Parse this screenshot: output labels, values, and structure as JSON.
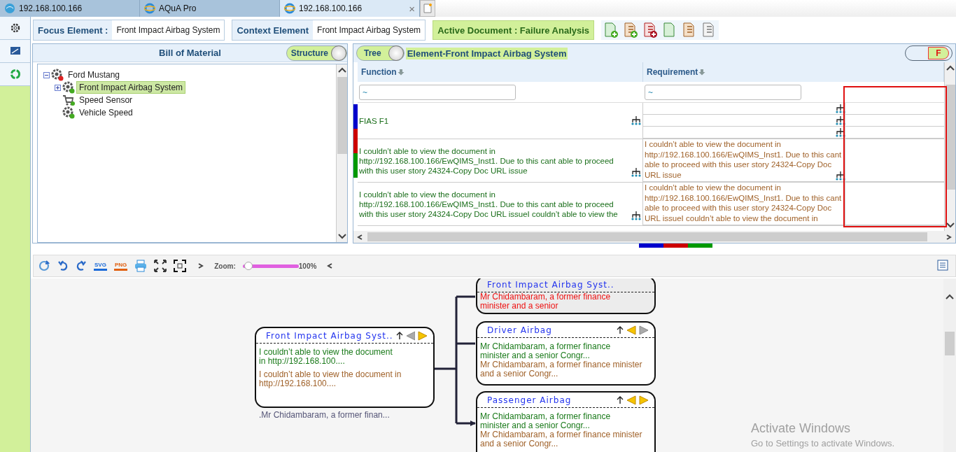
{
  "browser_tabs": [
    {
      "title": "192.168.100.166",
      "kind": "globe",
      "selected": false
    },
    {
      "title": "AQuA Pro",
      "kind": "ie",
      "selected": false
    },
    {
      "title": "192.168.100.166",
      "kind": "ie",
      "selected": true,
      "close": "×"
    }
  ],
  "sidebar": {
    "items": [
      {
        "kind": "settings"
      },
      {
        "kind": "screen"
      },
      {
        "kind": "cycle"
      }
    ]
  },
  "focus_element": {
    "label": "Focus Element :",
    "value": "Front Impact Airbag System"
  },
  "context_element": {
    "label": "Context Element",
    "value": "Front Impact Airbag System"
  },
  "active_document": {
    "label": "Active Document : Failure Analysis"
  },
  "doc_tools": [
    {
      "kind": "new-doc"
    },
    {
      "kind": "add-checklist"
    },
    {
      "kind": "remove-list"
    },
    {
      "kind": "doc"
    },
    {
      "kind": "checklist"
    },
    {
      "kind": "list"
    }
  ],
  "bom": {
    "title": "Bill of Material",
    "toggle": {
      "label": "Structure",
      "on": true
    },
    "tree": [
      {
        "label": "Ford Mustang",
        "kind": "assembly",
        "expanded": true,
        "selected": false,
        "children": [
          {
            "label": "Front Impact Airbag System",
            "kind": "system",
            "expanded": false,
            "selected": true
          },
          {
            "label": "Speed Sensor",
            "kind": "sensor",
            "selected": false
          },
          {
            "label": "Vehicle Speed",
            "kind": "function",
            "selected": false
          }
        ]
      }
    ]
  },
  "grid": {
    "toggle": {
      "label": "Tree",
      "on": true
    },
    "title": "Element-Front Impact Airbag System",
    "mode_toggle": {
      "label": "F",
      "on": true
    },
    "columns": [
      {
        "label": "Function"
      },
      {
        "label": "Requirement"
      }
    ],
    "filters": [
      "~",
      "~"
    ],
    "side_markers": [
      {
        "color": "#0000cc"
      },
      {
        "color": "#cc0000"
      },
      {
        "color": "#009900"
      }
    ],
    "rows": [
      {
        "function": "FIAS F1",
        "requirements": [
          {
            "kind": "empty"
          },
          {
            "kind": "empty"
          },
          {
            "kind": "empty"
          }
        ]
      },
      {
        "function": "I couldn’t able to view the document in http://192.168.100.166/EwQIMS_Inst1. Due to this cant able to proceed with this user story 24324-Copy Doc URL issue",
        "requirements": [
          {
            "kind": "text",
            "text": "I couldn’t able to view the document in http://192.168.100.166/EwQIMS_Inst1. Due to this cant able to proceed with this user story 24324-Copy Doc URL issue"
          }
        ]
      },
      {
        "function": "I couldn’t able to view the document in http://192.168.100.166/EwQIMS_Inst1. Due to this cant able to proceed with this user story 24324-Copy Doc URL issueI couldn’t able to view the",
        "requirements": [
          {
            "kind": "text",
            "text": "I couldn’t able to view the document in http://192.168.100.166/EwQIMS_Inst1. Due to this cant able to proceed with this user story 24324-Copy Doc URL issueI couldn’t able to view the document in"
          }
        ]
      }
    ],
    "bottom_markers": [
      {
        "color": "#0000cc"
      },
      {
        "color": "#cc0000"
      },
      {
        "color": "#009900"
      }
    ]
  },
  "diagram_toolbar": {
    "tools": [
      {
        "kind": "refresh"
      },
      {
        "kind": "undo"
      },
      {
        "kind": "redo"
      },
      {
        "kind": "export",
        "label": "SVG"
      },
      {
        "kind": "export",
        "label": "PNG"
      },
      {
        "kind": "print"
      },
      {
        "kind": "fit"
      },
      {
        "kind": "fullscreen"
      },
      {
        "kind": "next"
      }
    ],
    "zoom": {
      "label": "Zoom:",
      "level": 0.1,
      "reading": "100%"
    },
    "after_tools": [
      {
        "kind": "prev"
      }
    ],
    "side_tools": [
      {
        "kind": "legend"
      }
    ]
  },
  "diagram": {
    "root": {
      "title": "Front Impact Airbag Syst..",
      "selected": false,
      "controls": true,
      "left_enabled": false,
      "right_enabled": true,
      "lines": [
        {
          "kind": "function",
          "text": "I couldn’t able to view the document in http://192.168.100...."
        },
        {
          "kind": "requirement",
          "text": "I couldn’t able to view the document in http://192.168.100...."
        }
      ],
      "caption": ".Mr Chidambaram, a former finan..."
    },
    "children": [
      {
        "title": "Front Impact Airbag Syst..",
        "selected": true,
        "controls": false,
        "lines": [
          {
            "kind": "failure",
            "text": "Mr Chidambaram, a former finance minister and a senior"
          }
        ]
      },
      {
        "title": "Driver Airbag",
        "selected": false,
        "controls": true,
        "left_enabled": true,
        "right_enabled": false,
        "lines": [
          {
            "kind": "function",
            "text": "Mr Chidambaram, a former finance minister and a senior Congr..."
          },
          {
            "kind": "requirement",
            "text": "Mr Chidambaram, a former finance minister and a senior Congr..."
          }
        ]
      },
      {
        "title": "Passenger Airbag",
        "selected": false,
        "controls": true,
        "left_enabled": true,
        "right_enabled": true,
        "lines": [
          {
            "kind": "function",
            "text": "Mr Chidambaram, a former finance minister and a senior Congr..."
          },
          {
            "kind": "requirement",
            "text": "Mr Chidambaram, a former finance minister and a senior Congr..."
          }
        ]
      }
    ]
  },
  "os_notice": {
    "title": "Activate Windows",
    "body": "Go to Settings to activate Windows."
  }
}
